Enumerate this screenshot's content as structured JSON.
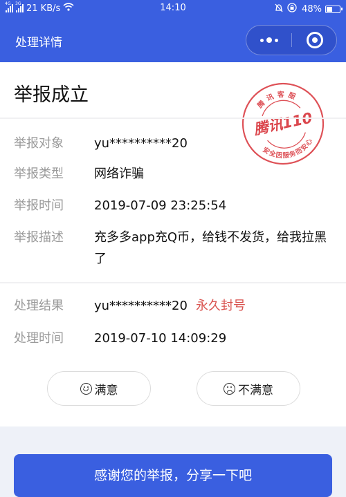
{
  "status_bar": {
    "network_1": "4G",
    "network_2": "3G",
    "speed": "21 KB/s",
    "time": "14:10",
    "battery_percent": "48%",
    "battery_level": 0.48
  },
  "nav": {
    "title": "处理详情"
  },
  "page": {
    "title": "举报成立",
    "stamp": {
      "top_text": "腾讯客服",
      "center_text": "腾讯110",
      "bottom_text": "安全因服务而安心",
      "color": "#d8333a"
    },
    "report": [
      {
        "label": "举报对象",
        "value": "yu**********20"
      },
      {
        "label": "举报类型",
        "value": "网络诈骗"
      },
      {
        "label": "举报时间",
        "value": "2019-07-09 23:25:54"
      },
      {
        "label": "举报描述",
        "value": "充多多app充Q币，给钱不发货，给我拉黑了"
      }
    ],
    "result": [
      {
        "label": "处理结果",
        "value": "yu**********20",
        "status": "永久封号"
      },
      {
        "label": "处理时间",
        "value": "2019-07-10 14:09:29"
      }
    ],
    "rating": {
      "satisfied": "满意",
      "unsatisfied": "不满意"
    },
    "share_button": "感谢您的举报，分享一下吧"
  },
  "colors": {
    "accent": "#3a5fe0",
    "danger": "#d9534f",
    "background": "#eef1f8"
  }
}
